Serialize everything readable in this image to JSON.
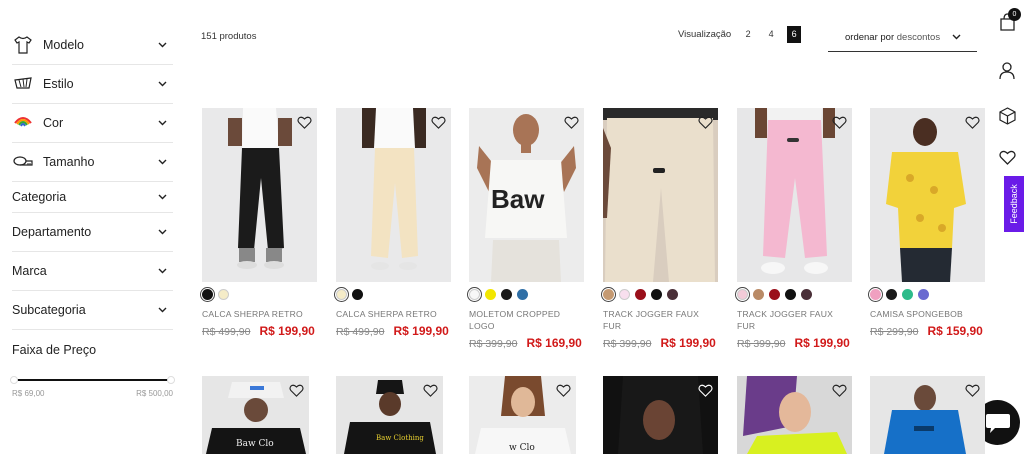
{
  "sidebar": {
    "filters": [
      {
        "label": "Modelo",
        "icon": "shirt-icon"
      },
      {
        "label": "Estilo",
        "icon": "cap-icon"
      },
      {
        "label": "Cor",
        "icon": "rainbow-icon"
      },
      {
        "label": "Tamanho",
        "icon": "ruler-icon"
      },
      {
        "label": "Categoria"
      },
      {
        "label": "Departamento"
      },
      {
        "label": "Marca"
      },
      {
        "label": "Subcategoria"
      },
      {
        "label": "Faixa de Preço"
      }
    ],
    "price": {
      "min_label": "R$ 69,00",
      "max_label": "R$ 500,00"
    }
  },
  "toolbar": {
    "count": "151 produtos",
    "view_label": "Visualização",
    "view_options": [
      "2",
      "4",
      "6"
    ],
    "view_selected": "6",
    "sort_prefix": "ordenar por",
    "sort_value": "descontos"
  },
  "rail": {
    "cart_count": "0",
    "feedback_label": "Feedback"
  },
  "products": [
    {
      "name": "CALCA SHERPA RETRO",
      "old_price": "R$ 499,90",
      "new_price": "R$ 199,90",
      "swatches": [
        "#111111",
        "#f5ecc8"
      ]
    },
    {
      "name": "CALCA SHERPA RETRO",
      "old_price": "R$ 499,90",
      "new_price": "R$ 199,90",
      "swatches": [
        "#f5ecc8",
        "#111111"
      ]
    },
    {
      "name": "MOLETOM CROPPED LOGO",
      "old_price": "R$ 399,90",
      "new_price": "R$ 169,90",
      "swatches": [
        "#f7f7f7",
        "#f2e600",
        "#1a1a1a",
        "#2f6fa6"
      ]
    },
    {
      "name": "TRACK JOGGER FAUX FUR",
      "old_price": "R$ 399,90",
      "new_price": "R$ 199,90",
      "swatches": [
        "#c59a72",
        "#f8dfee",
        "#9a0f1a",
        "#111111",
        "#4a2f38"
      ]
    },
    {
      "name": "TRACK JOGGER FAUX FUR",
      "old_price": "R$ 399,90",
      "new_price": "R$ 199,90",
      "swatches": [
        "#f3cbd8",
        "#b98a66",
        "#9a0f1a",
        "#111111",
        "#4a2f38"
      ]
    },
    {
      "name": "CAMISA SPONGEBOB",
      "old_price": "R$ 299,90",
      "new_price": "R$ 159,90",
      "swatches": [
        "#f0a0c0",
        "#1a1a1a",
        "#2dbb8a",
        "#6a6ad0"
      ]
    }
  ]
}
